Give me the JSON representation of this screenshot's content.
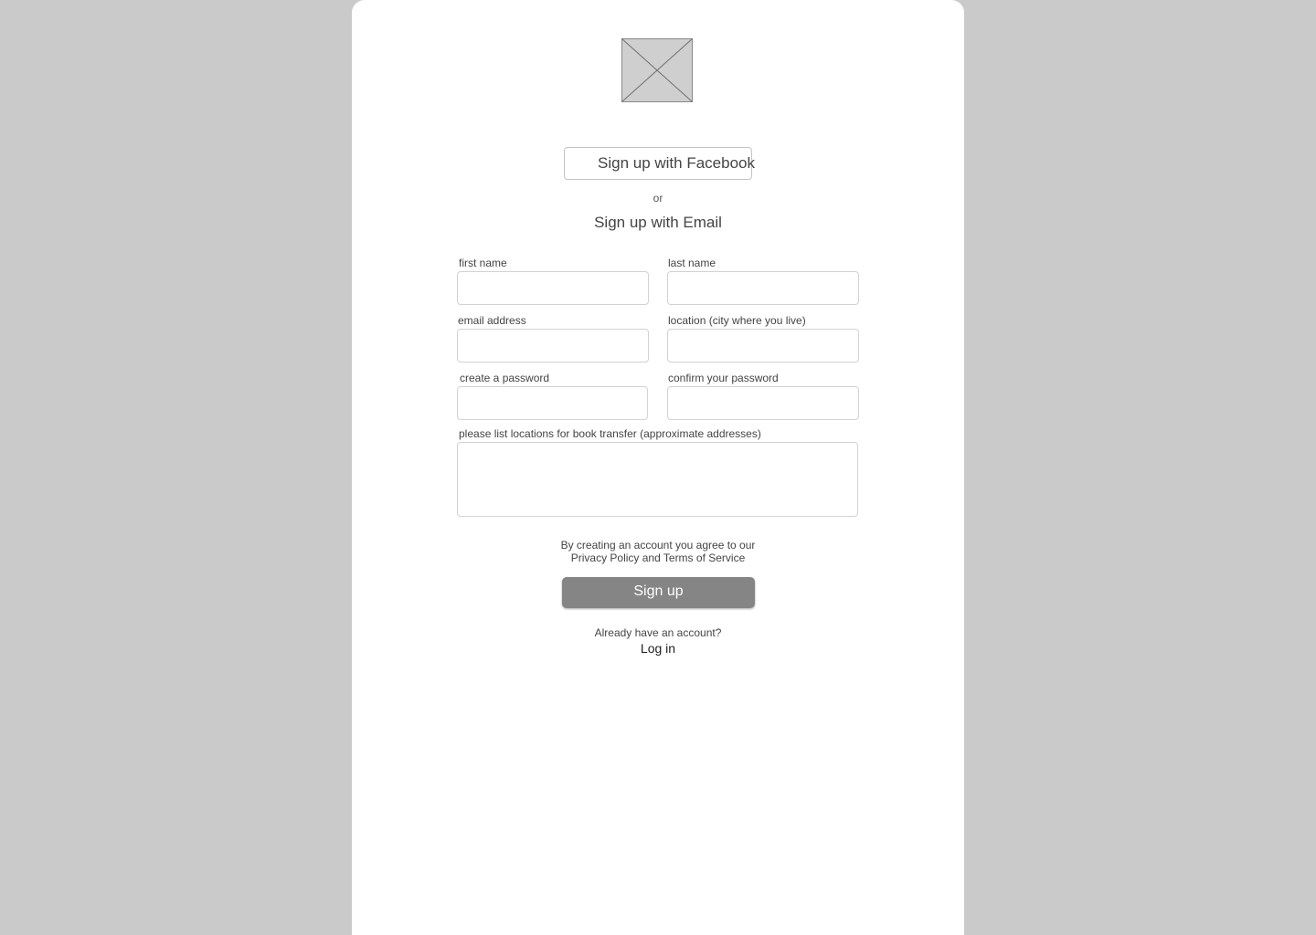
{
  "logo": {
    "icon": "image-placeholder-icon"
  },
  "facebook_button": {
    "label": "Sign up with Facebook"
  },
  "divider": {
    "text": "or"
  },
  "email_heading": "Sign up with Email",
  "form": {
    "first_name": {
      "label": "first name",
      "value": ""
    },
    "last_name": {
      "label": "last name",
      "value": ""
    },
    "email": {
      "label": "email address",
      "value": ""
    },
    "location": {
      "label": "location (city where you live)",
      "value": ""
    },
    "password": {
      "label": "create a password",
      "value": ""
    },
    "confirm_password": {
      "label": "confirm your password",
      "value": ""
    },
    "transfer_locations": {
      "label": "please list locations for book transfer (approximate addresses)",
      "value": ""
    }
  },
  "terms": {
    "line1": "By creating an account you agree to our",
    "line2": "Privacy Policy and Terms of Service"
  },
  "signup_button": {
    "label": "Sign up"
  },
  "login": {
    "prompt": "Already have an account?",
    "link": "Log in"
  },
  "colors": {
    "page_background": "#cacaca",
    "panel": "#ffffff",
    "signup_button": "#858585",
    "field_border": "#d2d2d2"
  }
}
